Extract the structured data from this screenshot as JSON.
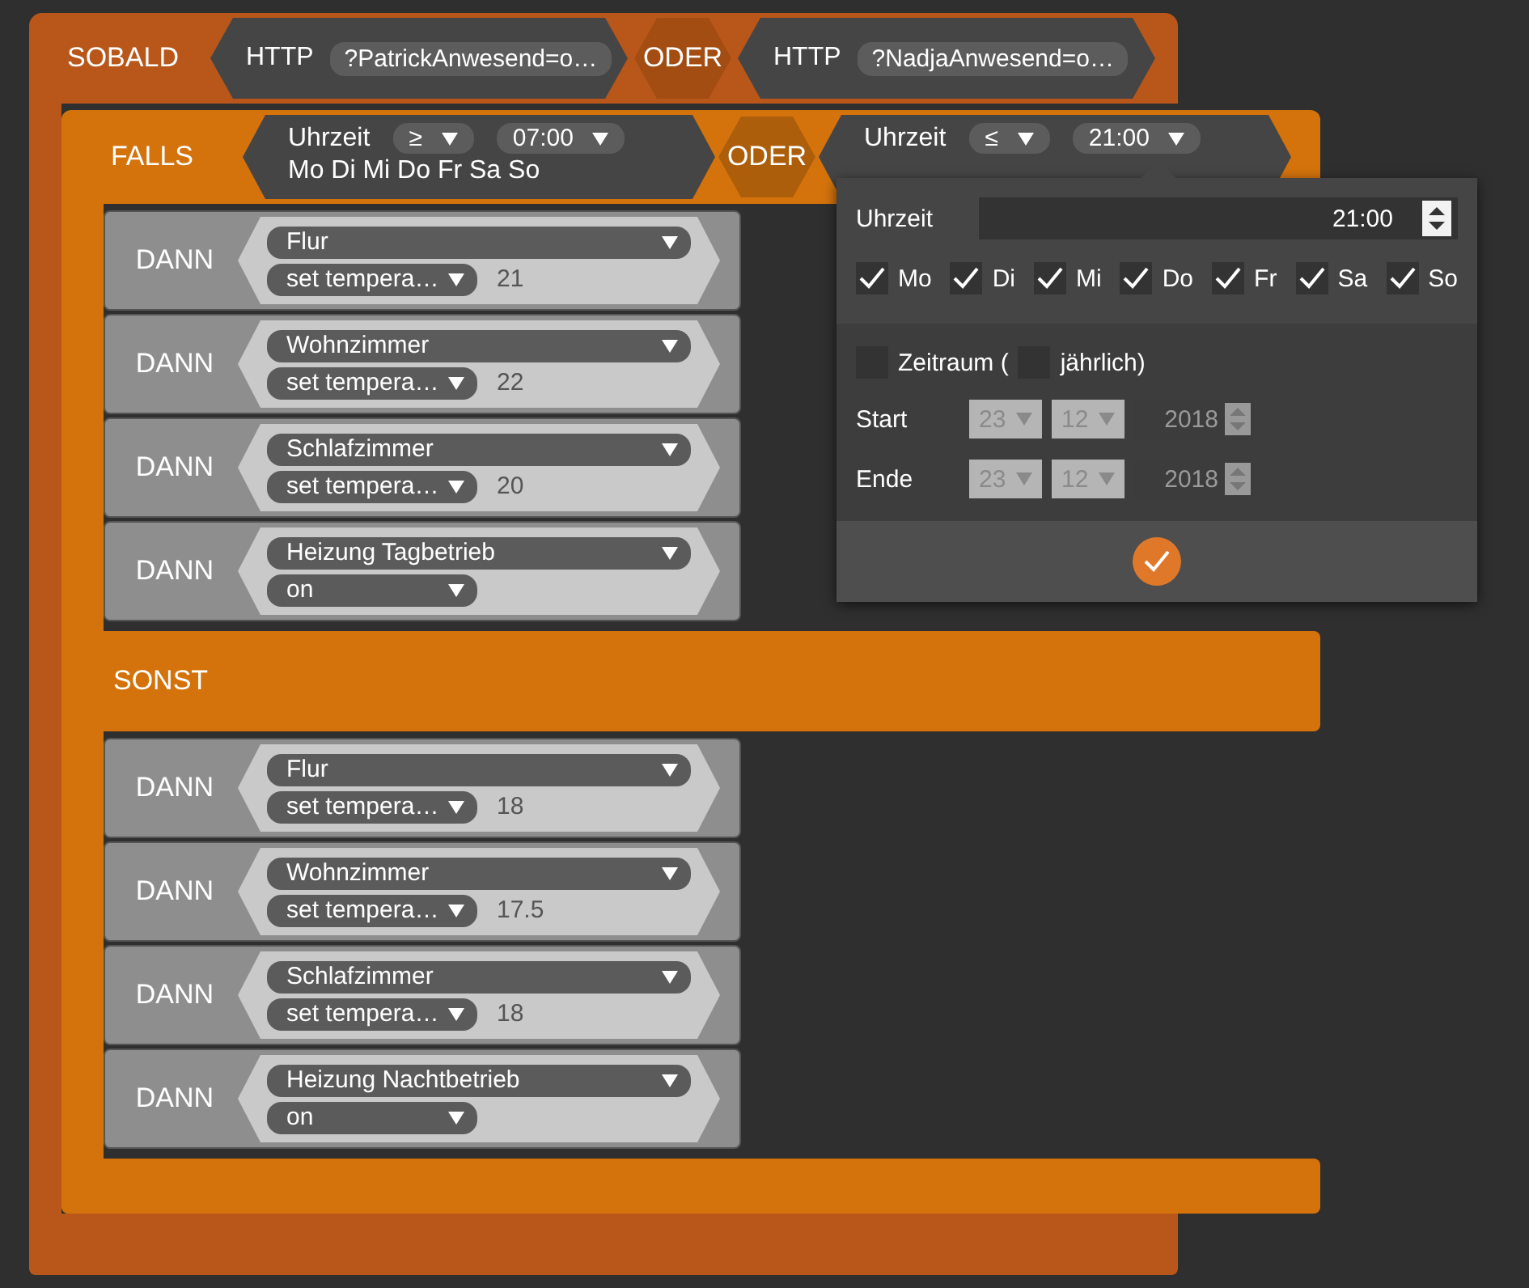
{
  "when": {
    "label": "SOBALD",
    "items": [
      {
        "kind": "http",
        "label": "HTTP",
        "value": "?PatrickAnwesend=o…"
      },
      {
        "kind": "operator",
        "label": "ODER"
      },
      {
        "kind": "http",
        "label": "HTTP",
        "value": "?NadjaAnwesend=o…"
      }
    ]
  },
  "if": {
    "label": "FALLS",
    "items": [
      {
        "kind": "time",
        "label": "Uhrzeit",
        "comparator": "≥",
        "time": "07:00",
        "days": "Mo Di Mi Do Fr Sa So"
      },
      {
        "kind": "operator",
        "label": "ODER"
      },
      {
        "kind": "time",
        "label": "Uhrzeit",
        "comparator": "≤",
        "time": "21:00"
      }
    ]
  },
  "then": [
    {
      "label": "DANN",
      "device": "Flur",
      "action": "set tempera…",
      "value": "21"
    },
    {
      "label": "DANN",
      "device": "Wohnzimmer",
      "action": "set tempera…",
      "value": "22"
    },
    {
      "label": "DANN",
      "device": "Schlafzimmer",
      "action": "set tempera…",
      "value": "20"
    },
    {
      "label": "DANN",
      "device": "Heizung Tagbetrieb",
      "action": "on"
    }
  ],
  "else": {
    "label": "SONST",
    "actions": [
      {
        "label": "DANN",
        "device": "Flur",
        "action": "set tempera…",
        "value": "18"
      },
      {
        "label": "DANN",
        "device": "Wohnzimmer",
        "action": "set tempera…",
        "value": "17.5"
      },
      {
        "label": "DANN",
        "device": "Schlafzimmer",
        "action": "set tempera…",
        "value": "18"
      },
      {
        "label": "DANN",
        "device": "Heizung Nachtbetrieb",
        "action": "on"
      }
    ]
  },
  "popup": {
    "time_label": "Uhrzeit",
    "time": "21:00",
    "days": [
      {
        "label": "Mo",
        "checked": true
      },
      {
        "label": "Di",
        "checked": true
      },
      {
        "label": "Mi",
        "checked": true
      },
      {
        "label": "Do",
        "checked": true
      },
      {
        "label": "Fr",
        "checked": true
      },
      {
        "label": "Sa",
        "checked": true
      },
      {
        "label": "So",
        "checked": true
      }
    ],
    "period": {
      "label": "Zeitraum (",
      "checked": false,
      "yearly_label": "jährlich)",
      "yearly_checked": false
    },
    "ranges": [
      {
        "label": "Start",
        "day": "23",
        "month": "12",
        "year": "2018"
      },
      {
        "label": "Ende",
        "day": "23",
        "month": "12",
        "year": "2018"
      }
    ]
  }
}
